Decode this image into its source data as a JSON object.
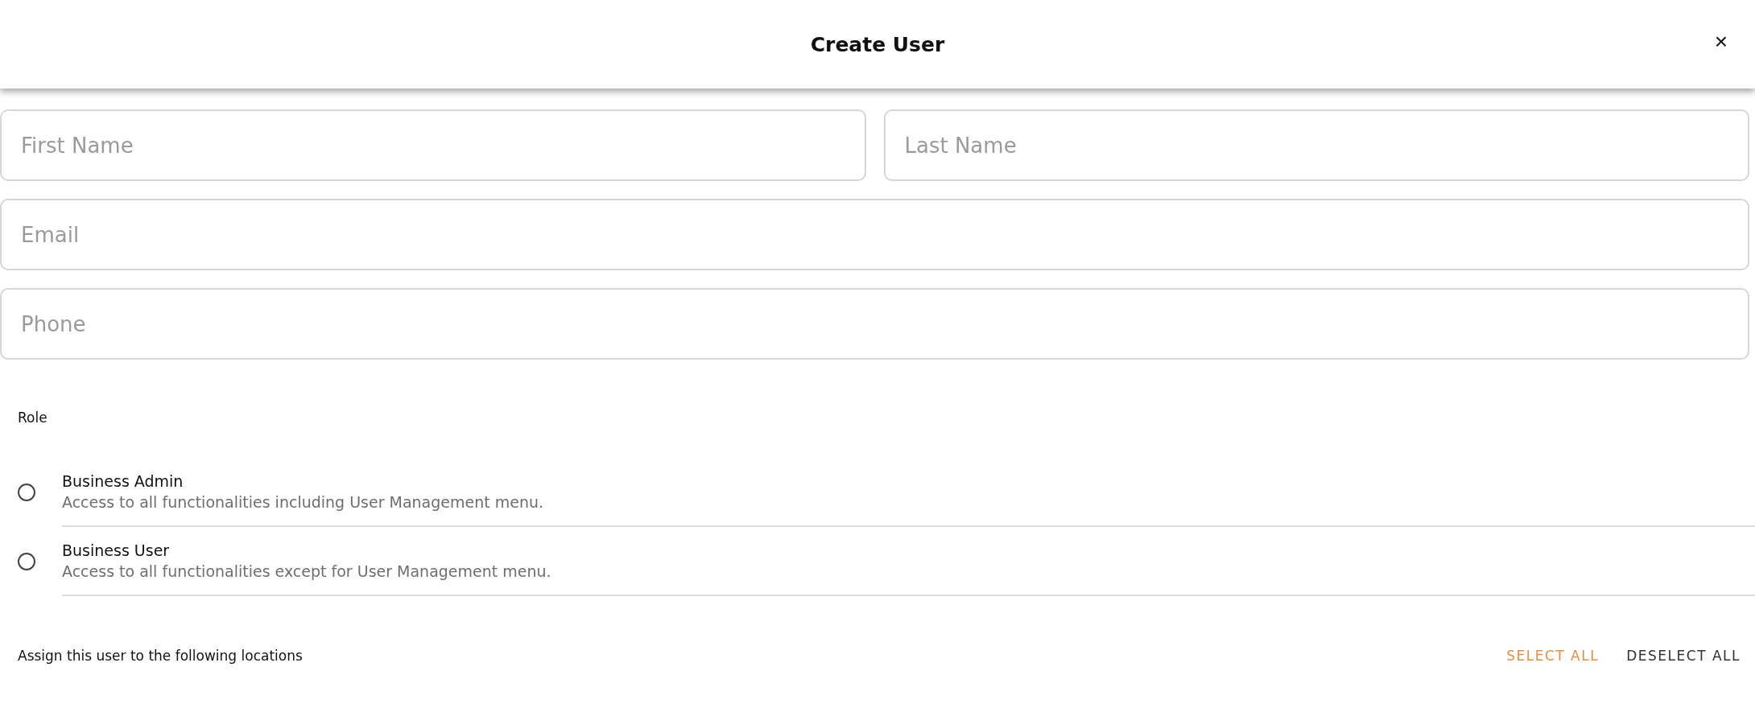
{
  "dialog": {
    "title": "Create User",
    "close": "×"
  },
  "fields": [
    {
      "placeholder": "First Name",
      "half": true
    },
    {
      "placeholder": "Last Name",
      "half": true
    },
    {
      "placeholder": "Email",
      "half": false
    },
    {
      "placeholder": "Phone",
      "half": false
    }
  ],
  "role": {
    "label": "Role",
    "options": [
      {
        "title": "Business Admin",
        "description": "Access to all functionalities including User Management menu.",
        "selected": false
      },
      {
        "title": "Business User",
        "description": "Access to all functionalities except for User Management menu.",
        "selected": false
      }
    ]
  },
  "locations": {
    "label": "Assign this user to the following locations",
    "actions": [
      {
        "label": "SELECT ALL",
        "kind": "primary"
      },
      {
        "label": "DESELECT ALL",
        "kind": "secondary"
      }
    ]
  }
}
